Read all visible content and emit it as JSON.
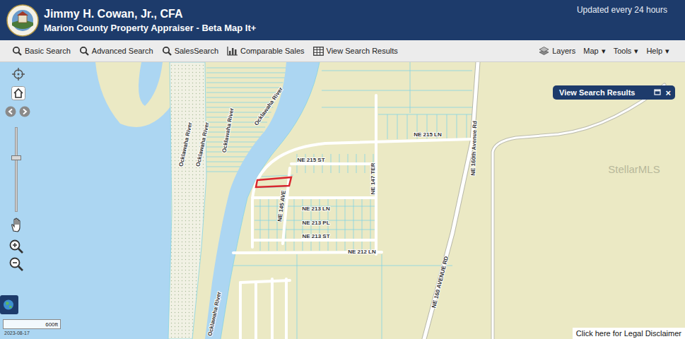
{
  "header": {
    "title": "Jimmy H. Cowan, Jr., CFA",
    "subtitle": "Marion County Property Appraiser - Beta Map It+",
    "updated": "Updated every 24 hours"
  },
  "toolbar": {
    "left": [
      {
        "label": "Basic Search",
        "kind": "search"
      },
      {
        "label": "Advanced Search",
        "kind": "search"
      },
      {
        "label": "SalesSearch",
        "kind": "search"
      },
      {
        "label": "Comparable Sales",
        "kind": "chart"
      },
      {
        "label": "View Search Results",
        "kind": "table"
      }
    ],
    "right": [
      {
        "label": "Layers",
        "kind": "layers"
      },
      {
        "label": "Map",
        "kind": "menu",
        "caret": "▾"
      },
      {
        "label": "Tools",
        "kind": "menu",
        "caret": "▾"
      },
      {
        "label": "Help",
        "kind": "menu",
        "caret": "▾"
      }
    ]
  },
  "panel": {
    "title": "View Search Results",
    "close": "×"
  },
  "zoom": {
    "level": 0.64
  },
  "map": {
    "labels": [
      {
        "text": "Ocklawaha River"
      },
      {
        "text": "Ocklawaha River"
      },
      {
        "text": "Ocklawaha River"
      },
      {
        "text": "Ocklawaha River"
      },
      {
        "text": "Ocklawaha River"
      },
      {
        "text": "NE 215 LN"
      },
      {
        "text": "NE 215 ST"
      },
      {
        "text": "NE 213 LN"
      },
      {
        "text": "NE 213 PL"
      },
      {
        "text": "NE 213 ST"
      },
      {
        "text": "NE 212 LN"
      },
      {
        "text": "NE 145 AVE"
      },
      {
        "text": "NE 147 TER"
      },
      {
        "text": "NE 160th Avenue Rd"
      },
      {
        "text": "NE 160 AVENUE RD"
      }
    ],
    "parcel": {
      "selected": true
    },
    "watermark": "StellarMLS",
    "scale": "600ft",
    "date": "2023-08-17"
  },
  "disclaimer": "Click here for Legal Disclaimer"
}
